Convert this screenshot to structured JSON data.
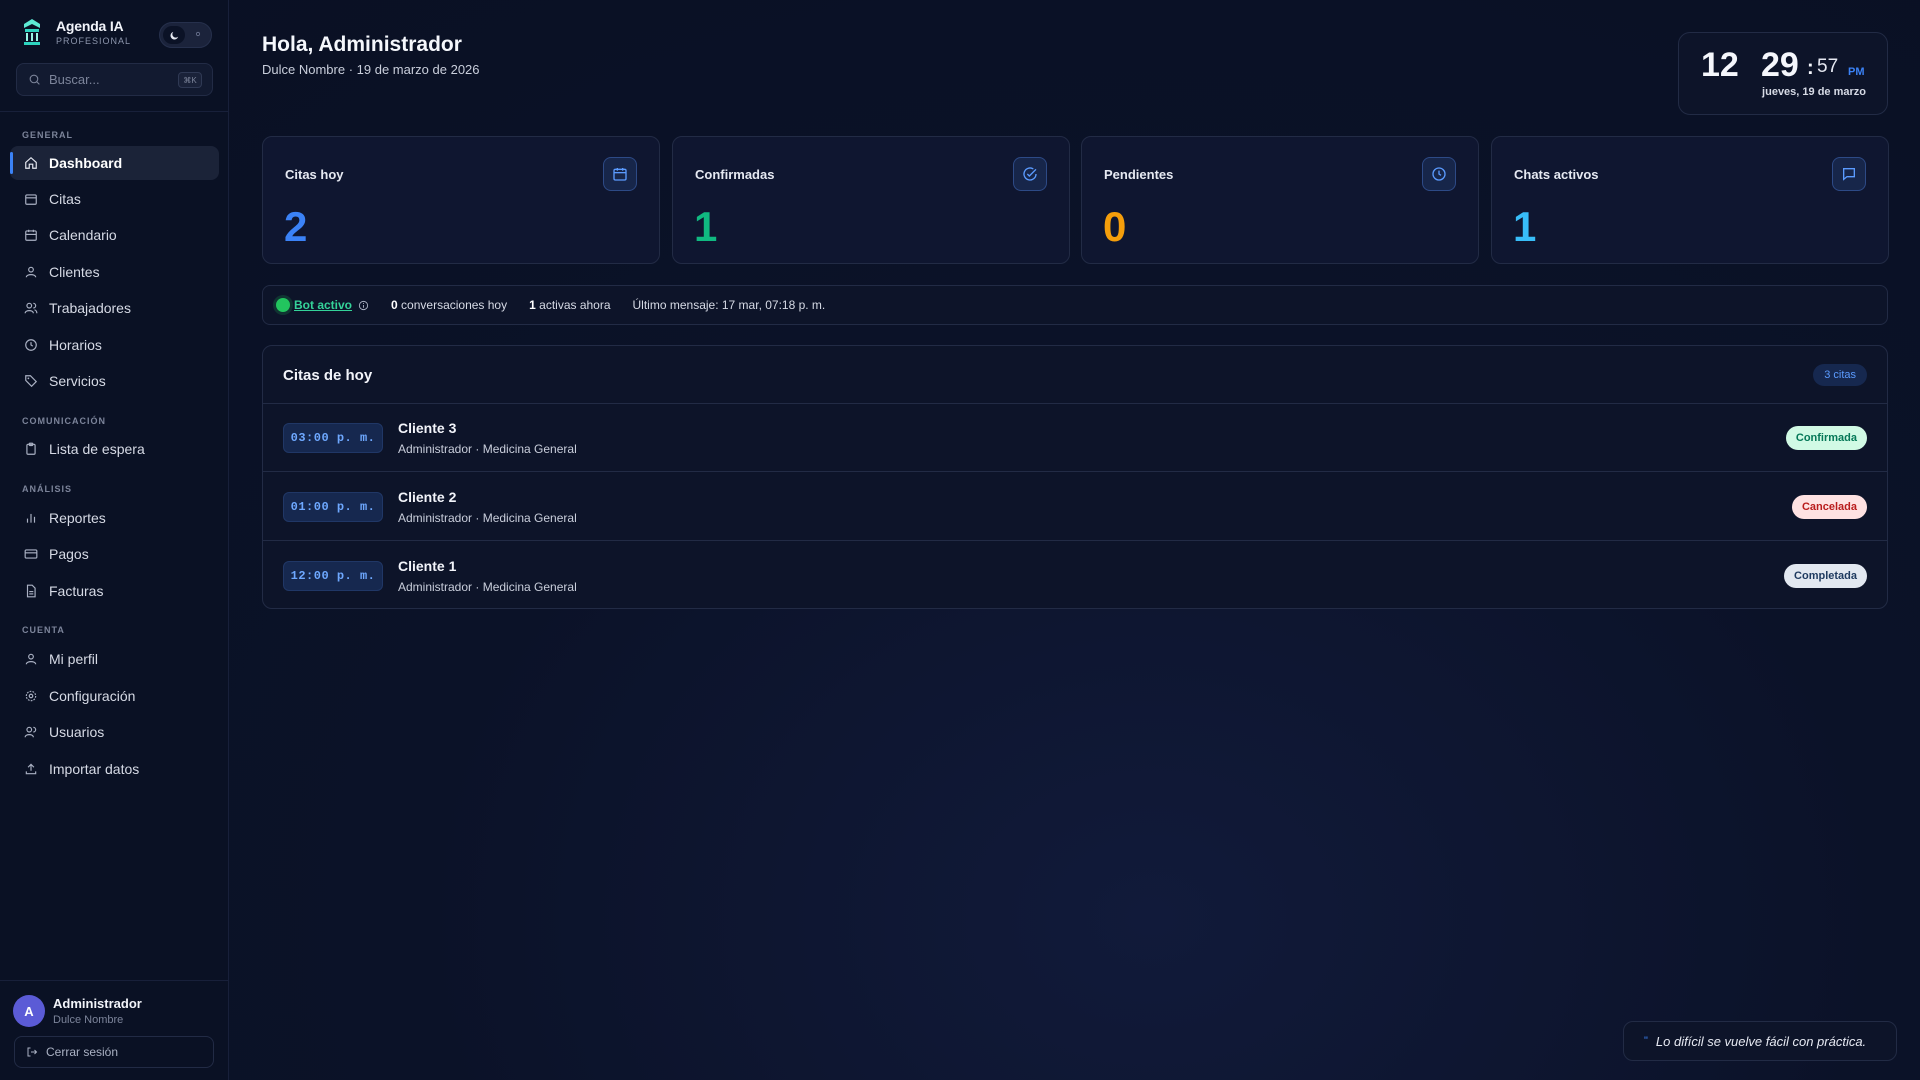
{
  "brand": {
    "name": "Agenda IA",
    "subtitle": "PROFESIONAL"
  },
  "search": {
    "placeholder": "Buscar...",
    "shortcut": "⌘K"
  },
  "nav": {
    "sections": {
      "general": "GENERAL",
      "comunicacion": "COMUNICACIÓN",
      "analisis": "ANÁLISIS",
      "cuenta": "CUENTA"
    },
    "items": [
      {
        "label": "Dashboard",
        "icon": "home-icon",
        "active": true
      },
      {
        "label": "Citas",
        "icon": "calendar-icon"
      },
      {
        "label": "Calendario",
        "icon": "calendar-grid-icon"
      },
      {
        "label": "Clientes",
        "icon": "user-icon"
      },
      {
        "label": "Trabajadores",
        "icon": "users-icon"
      },
      {
        "label": "Horarios",
        "icon": "clock-icon"
      },
      {
        "label": "Servicios",
        "icon": "tag-icon"
      },
      {
        "label": "Lista de espera",
        "icon": "clipboard-icon"
      },
      {
        "label": "Reportes",
        "icon": "bar-chart-icon"
      },
      {
        "label": "Pagos",
        "icon": "credit-card-icon"
      },
      {
        "label": "Facturas",
        "icon": "document-icon"
      },
      {
        "label": "Mi perfil",
        "icon": "user-circle-icon"
      },
      {
        "label": "Configuración",
        "icon": "gear-icon"
      },
      {
        "label": "Usuarios",
        "icon": "users-icon"
      },
      {
        "label": "Importar datos",
        "icon": "upload-icon"
      }
    ]
  },
  "user": {
    "initial": "A",
    "name": "Administrador",
    "org": "Dulce Nombre",
    "logout_label": "Cerrar sesión"
  },
  "header": {
    "greeting": "Hola, Administrador",
    "subtitle": "Dulce Nombre · 19 de marzo de 2026"
  },
  "clock": {
    "hours": "12",
    "minutes": "29",
    "seconds": "57",
    "ampm": "PM",
    "date": "jueves, 19 de marzo"
  },
  "stats": [
    {
      "label": "Citas hoy",
      "value": "2",
      "color": "#3b82f6",
      "icon": "calendar-icon"
    },
    {
      "label": "Confirmadas",
      "value": "1",
      "color": "#10b981",
      "icon": "check-circle-icon"
    },
    {
      "label": "Pendientes",
      "value": "0",
      "color": "#f59e0b",
      "icon": "clock-icon"
    },
    {
      "label": "Chats activos",
      "value": "1",
      "color": "#38bdf8",
      "icon": "chat-icon"
    }
  ],
  "bot": {
    "status": "Bot activo",
    "conversations_count": "0",
    "conversations_label": "conversaciones hoy",
    "active_count": "1",
    "active_label": "activas ahora",
    "last_message": "Último mensaje: 17 mar, 07:18 p. m."
  },
  "appointments": {
    "title": "Citas de hoy",
    "count_label": "3 citas",
    "rows": [
      {
        "time": "03:00 p. m.",
        "client": "Cliente 3",
        "meta": "Administrador · Medicina General",
        "status": "Confirmada",
        "status_bg": "#d1fae5",
        "status_fg": "#047857"
      },
      {
        "time": "01:00 p. m.",
        "client": "Cliente 2",
        "meta": "Administrador · Medicina General",
        "status": "Cancelada",
        "status_bg": "#fee2e2",
        "status_fg": "#b91c1c"
      },
      {
        "time": "12:00 p. m.",
        "client": "Cliente 1",
        "meta": "Administrador · Medicina General",
        "status": "Completada",
        "status_bg": "#e2e8f0",
        "status_fg": "#1e3a5f"
      }
    ]
  },
  "quote": {
    "text": "Lo difícil se vuelve fácil con práctica."
  }
}
